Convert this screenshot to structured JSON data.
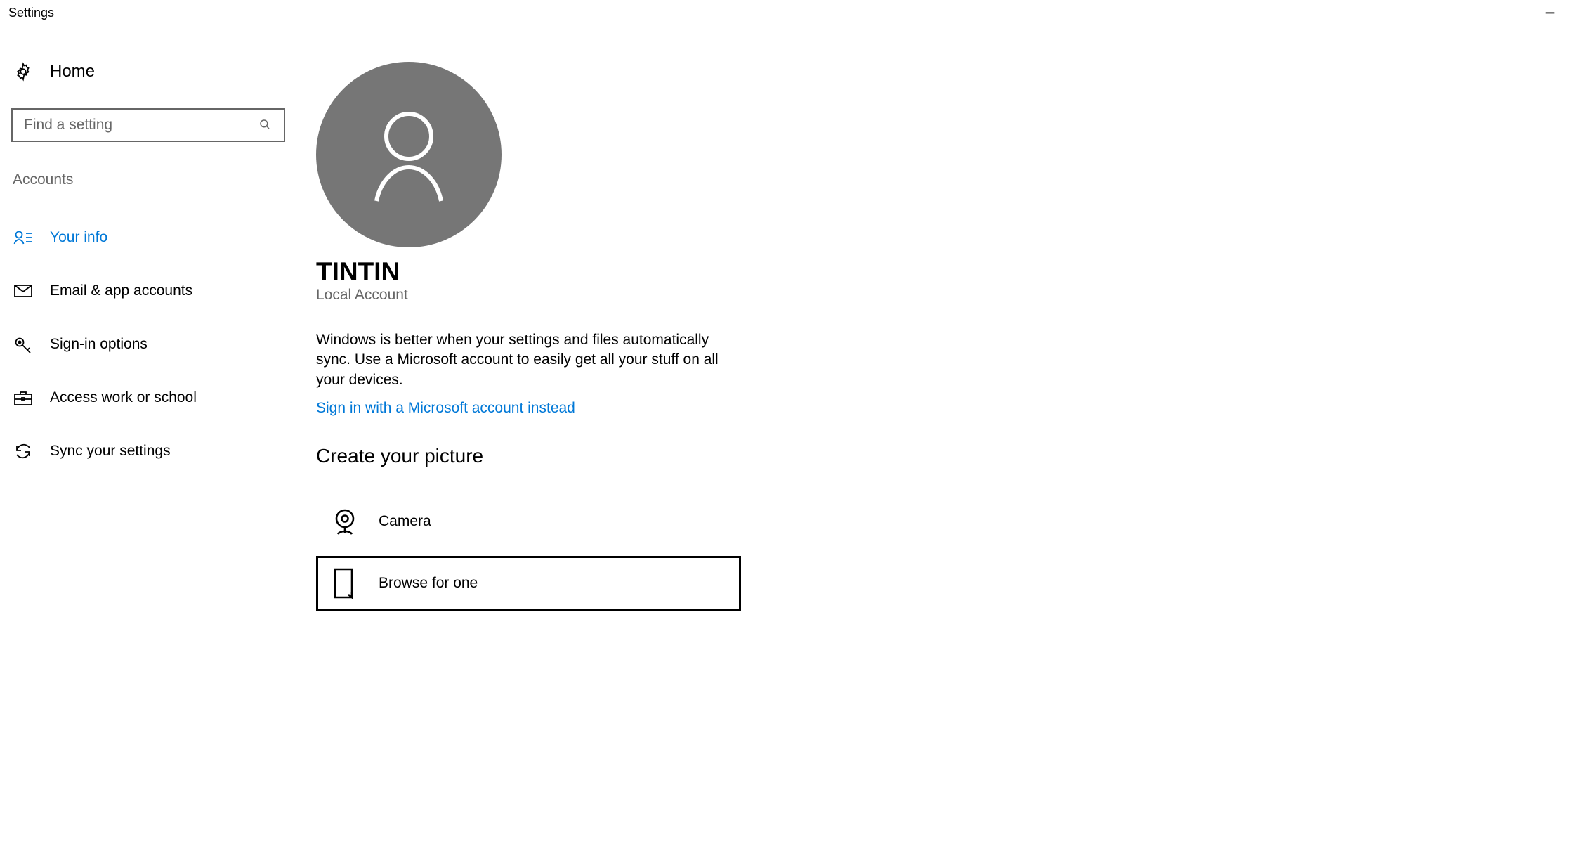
{
  "titlebar": {
    "title": "Settings"
  },
  "sidebar": {
    "home_label": "Home",
    "search_placeholder": "Find a setting",
    "category": "Accounts",
    "items": [
      {
        "label": "Your info",
        "icon": "user-card-icon",
        "active": true
      },
      {
        "label": "Email & app accounts",
        "icon": "mail-icon",
        "active": false
      },
      {
        "label": "Sign-in options",
        "icon": "key-icon",
        "active": false
      },
      {
        "label": "Access work or school",
        "icon": "briefcase-icon",
        "active": false
      },
      {
        "label": "Sync your settings",
        "icon": "sync-icon",
        "active": false
      }
    ]
  },
  "main": {
    "user_name": "TINTIN",
    "account_type": "Local Account",
    "info_text": "Windows is better when your settings and files automatically sync. Use a Microsoft account to easily get all your stuff on all your devices.",
    "sign_in_link": "Sign in with a Microsoft account instead",
    "create_picture_heading": "Create your picture",
    "camera_label": "Camera",
    "browse_label": "Browse for one"
  },
  "colors": {
    "accent": "#0078d7",
    "gray_text": "#666666",
    "avatar_bg": "#767676"
  }
}
